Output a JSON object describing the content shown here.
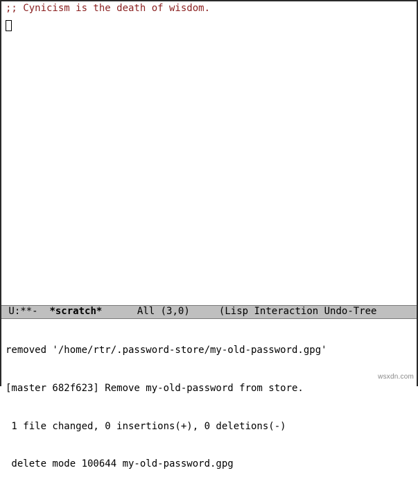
{
  "buffer": {
    "comment": ";; Cynicism is the death of wisdom."
  },
  "mode_line": {
    "left_flags": " U:**- ",
    "buffer_name": " *scratch*",
    "spacer1": "      ",
    "position": "All (3,0)",
    "spacer2": "     ",
    "modes": "(Lisp Interaction Undo-Tree"
  },
  "echo": {
    "line1": "removed '/home/rtr/.password-store/my-old-password.gpg'",
    "line2": "[master 682f623] Remove my-old-password from store.",
    "line3": " 1 file changed, 0 insertions(+), 0 deletions(-)",
    "line4": " delete mode 100644 my-old-password.gpg"
  },
  "watermark": "wsxdn.com"
}
